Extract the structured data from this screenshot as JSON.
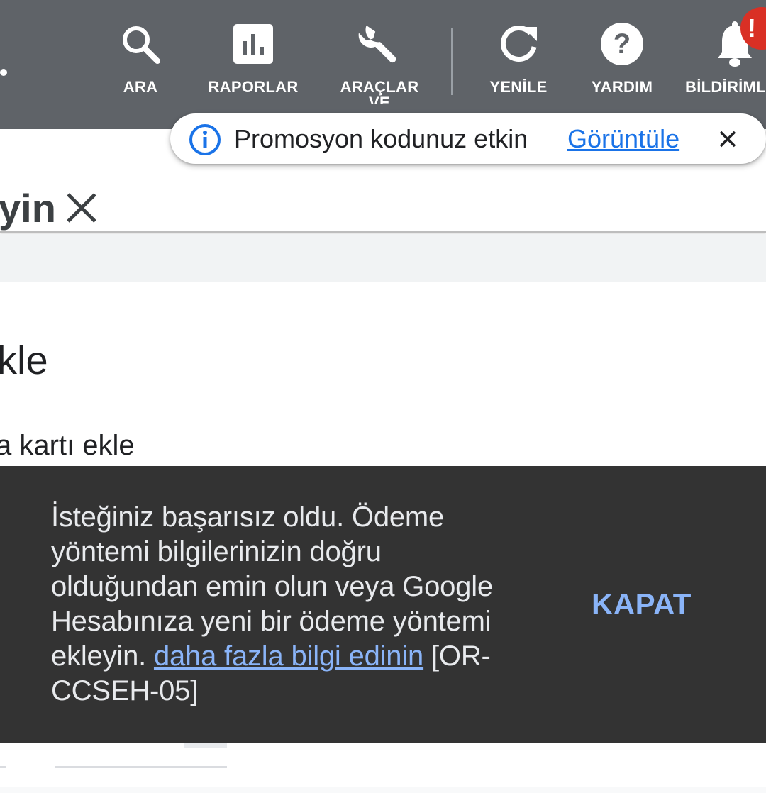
{
  "toolbar": {
    "search_label": "ARA",
    "reports_label": "RAPORLAR",
    "tools_label": "ARAÇLAR VE",
    "refresh_label": "YENİLE",
    "help_label": "YARDIM",
    "notifications_label": "BİLDİRİML",
    "alert_badge": "!",
    "icons": [
      "search-icon",
      "bar-chart-icon",
      "wrench-icon",
      "refresh-icon",
      "help-icon",
      "bell-icon"
    ]
  },
  "promo": {
    "text": "Promosyon kodunuz etkin",
    "link": "Görüntüle"
  },
  "header": {
    "title_fragment": "yin"
  },
  "content": {
    "heading_fragment": "kle",
    "subline_fragment": "a kartı ekle"
  },
  "snackbar": {
    "message_before_link": "İsteğiniz başarısız oldu. Ödeme yöntemi bilgilerinizin doğru olduğundan emin olun veya Google Hesabınıza yeni bir ödeme yöntemi ekleyin. ",
    "link": "daha fazla bilgi edinin",
    "message_after_link": " [OR-CCSEH-05]",
    "action": "KAPAT"
  },
  "colors": {
    "toolbar_bg": "#5f6368",
    "accent_blue": "#1a73e8",
    "snackbar_bg": "#333333",
    "snackbar_link": "#8ab4f8",
    "alert_red": "#d93025"
  }
}
